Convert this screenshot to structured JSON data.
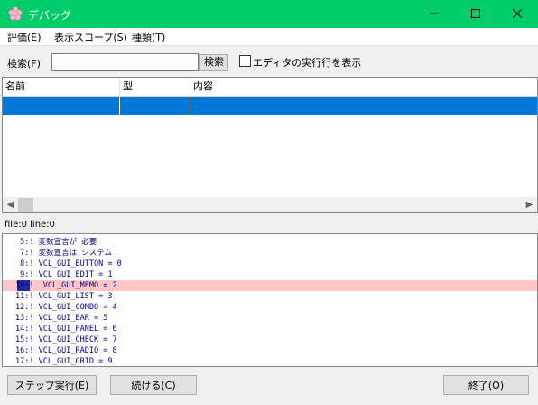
{
  "window": {
    "title": "デバッグ",
    "accent": "#00cc6a"
  },
  "menu": {
    "items": [
      "評価(E)",
      "表示スコープ(S)",
      "種類(T)"
    ]
  },
  "search": {
    "label": "検索(F)",
    "value": "",
    "button": "検索",
    "checkbox_label": "エディタの実行行を表示",
    "checkbox_checked": false
  },
  "list": {
    "columns": [
      "名前",
      "型",
      "内容"
    ],
    "selected_row_color": "#0078d7"
  },
  "status": {
    "text": "file:0 line:0"
  },
  "source": {
    "lines": [
      " 5:! 変数宣言が 必要",
      " 7:! 変数宣言は システム",
      " 8:! VCL_GUI_BUTTON = 0",
      " 9:! VCL_GUI_EDIT = 1",
      "10:!  VCL_GUI_MEMO = 2",
      "11:! VCL_GUI_LIST = 3",
      "12:! VCL_GUI_COMBO = 4",
      "13:! VCL_GUI_BAR = 5",
      "14:! VCL_GUI_PANEL = 6",
      "15:! VCL_GUI_CHECK = 7",
      "16:! VCL_GUI_RADIO = 8",
      "17:! VCL_GUI_GRID = 9"
    ],
    "highlight_index": 4,
    "highlight_color": "#ffc6c6"
  },
  "buttons": {
    "step": "ステップ実行(E)",
    "continue": "続ける(C)",
    "end": "終了(O)"
  }
}
